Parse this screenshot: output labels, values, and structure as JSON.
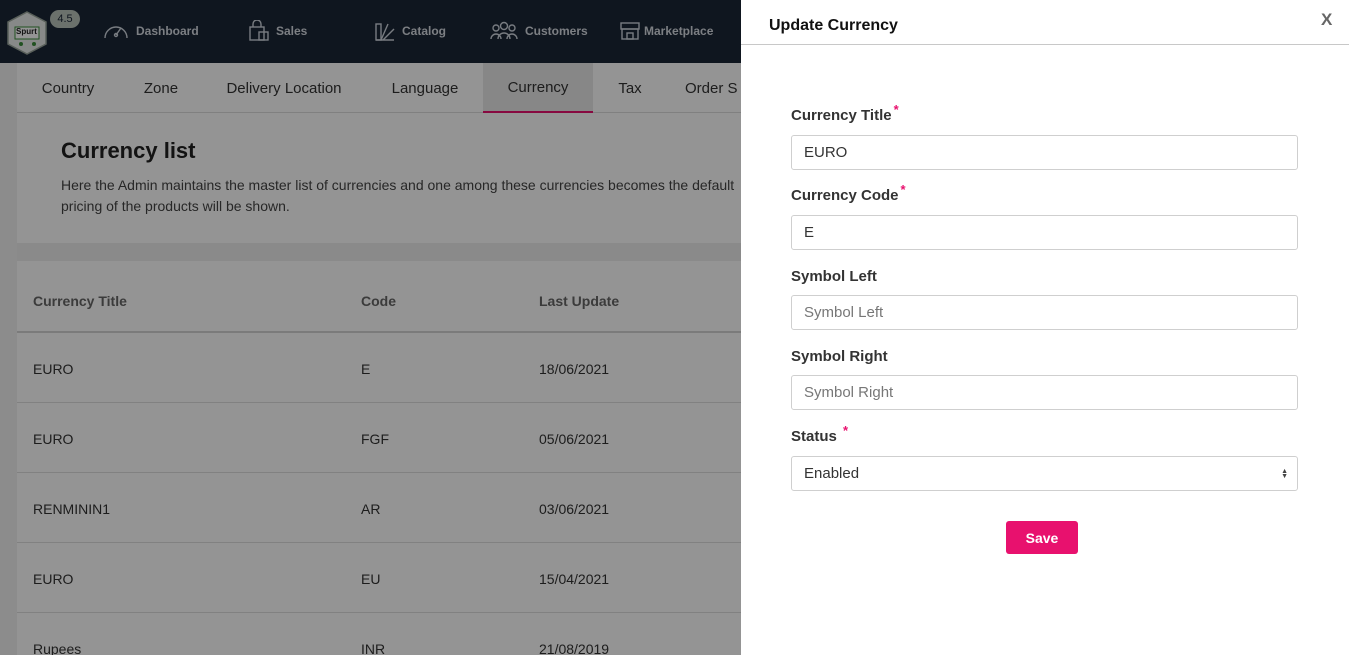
{
  "app": {
    "version": "4.5",
    "logo_text": "Spurt"
  },
  "nav": [
    {
      "label": "Dashboard",
      "icon": "speedometer-icon"
    },
    {
      "label": "Sales",
      "icon": "shopping-bag-icon"
    },
    {
      "label": "Catalog",
      "icon": "catalog-icon"
    },
    {
      "label": "Customers",
      "icon": "users-icon"
    },
    {
      "label": "Marketplace",
      "icon": "store-icon"
    }
  ],
  "tabs": [
    "Country",
    "Zone",
    "Delivery Location",
    "Language",
    "Currency",
    "Tax",
    "Order S"
  ],
  "active_tab": "Currency",
  "page": {
    "title": "Currency list",
    "description": "Here the Admin maintains the master list of currencies and one among these currencies becomes the default pricing of the products will be shown."
  },
  "table": {
    "headers": [
      "Currency Title",
      "Code",
      "Last Update"
    ],
    "rows": [
      [
        "EURO",
        "E",
        "18/06/2021"
      ],
      [
        "EURO",
        "FGF",
        "05/06/2021"
      ],
      [
        "RENMININ1",
        "AR",
        "03/06/2021"
      ],
      [
        "EURO",
        "EU",
        "15/04/2021"
      ],
      [
        "Rupees",
        "INR",
        "21/08/2019"
      ]
    ]
  },
  "panel": {
    "title": "Update Currency",
    "close_label": "X",
    "required_mark": "*",
    "fields": {
      "title": {
        "label": "Currency Title",
        "value": "EURO",
        "placeholder": ""
      },
      "code": {
        "label": "Currency Code",
        "value": "E",
        "placeholder": ""
      },
      "symbol_left": {
        "label": "Symbol Left",
        "value": "",
        "placeholder": "Symbol Left"
      },
      "symbol_right": {
        "label": "Symbol Right",
        "value": "",
        "placeholder": "Symbol Right"
      },
      "status": {
        "label": "Status",
        "value": "Enabled"
      }
    },
    "save_label": "Save"
  },
  "colors": {
    "accent": "#e8116e",
    "nav_bg": "#1b2636"
  }
}
